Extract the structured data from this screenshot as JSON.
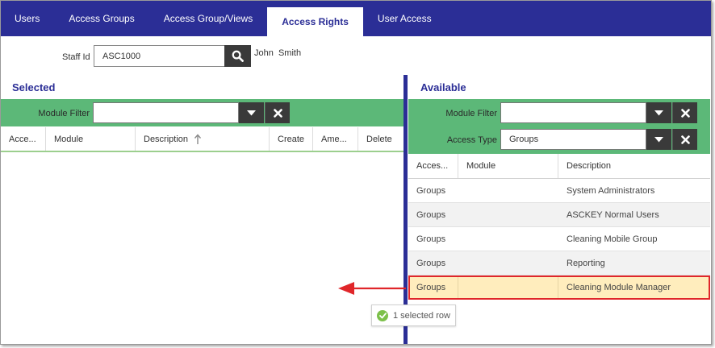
{
  "tabs": [
    {
      "label": "Users",
      "active": false
    },
    {
      "label": "Access Groups",
      "active": false
    },
    {
      "label": "Access Group/Views",
      "active": false
    },
    {
      "label": "Access Rights",
      "active": true
    },
    {
      "label": "User Access",
      "active": false
    }
  ],
  "staff": {
    "label": "Staff Id",
    "value": "ASC1000",
    "name": "John  Smith"
  },
  "selected": {
    "title": "Selected",
    "module_filter_label": "Module Filter",
    "module_filter_value": "",
    "columns": [
      "Acce...",
      "Module",
      "Description",
      "Create",
      "Ame...",
      "Delete"
    ],
    "sort_column": "Description"
  },
  "available": {
    "title": "Available",
    "module_filter_label": "Module Filter",
    "module_filter_value": "",
    "access_type_label": "Access Type",
    "access_type_value": "Groups",
    "columns": [
      "Acces...",
      "Module",
      "Description"
    ],
    "rows": [
      {
        "access": "Groups",
        "module": "",
        "description": "System Administrators",
        "selected": false
      },
      {
        "access": "Groups",
        "module": "",
        "description": "ASCKEY Normal Users",
        "selected": false
      },
      {
        "access": "Groups",
        "module": "",
        "description": "Cleaning Mobile Group",
        "selected": false
      },
      {
        "access": "Groups",
        "module": "",
        "description": "Reporting",
        "selected": false
      },
      {
        "access": "Groups",
        "module": "",
        "description": "Cleaning Module Manager",
        "selected": true
      }
    ]
  },
  "selection_badge": "1 selected row",
  "colors": {
    "nav": "#2b2e96",
    "filter_bar": "#5cb878",
    "button_dark": "#3a3a3a",
    "selected_row": "#ffedbd",
    "highlight": "#e0262a",
    "check": "#7cc04a"
  },
  "icons": {
    "search": "search-icon",
    "dropdown": "caret-down-icon",
    "clear": "close-icon",
    "sort": "sort-ascending-icon",
    "arrow": "arrow-left-icon",
    "check": "check-circle-icon"
  }
}
